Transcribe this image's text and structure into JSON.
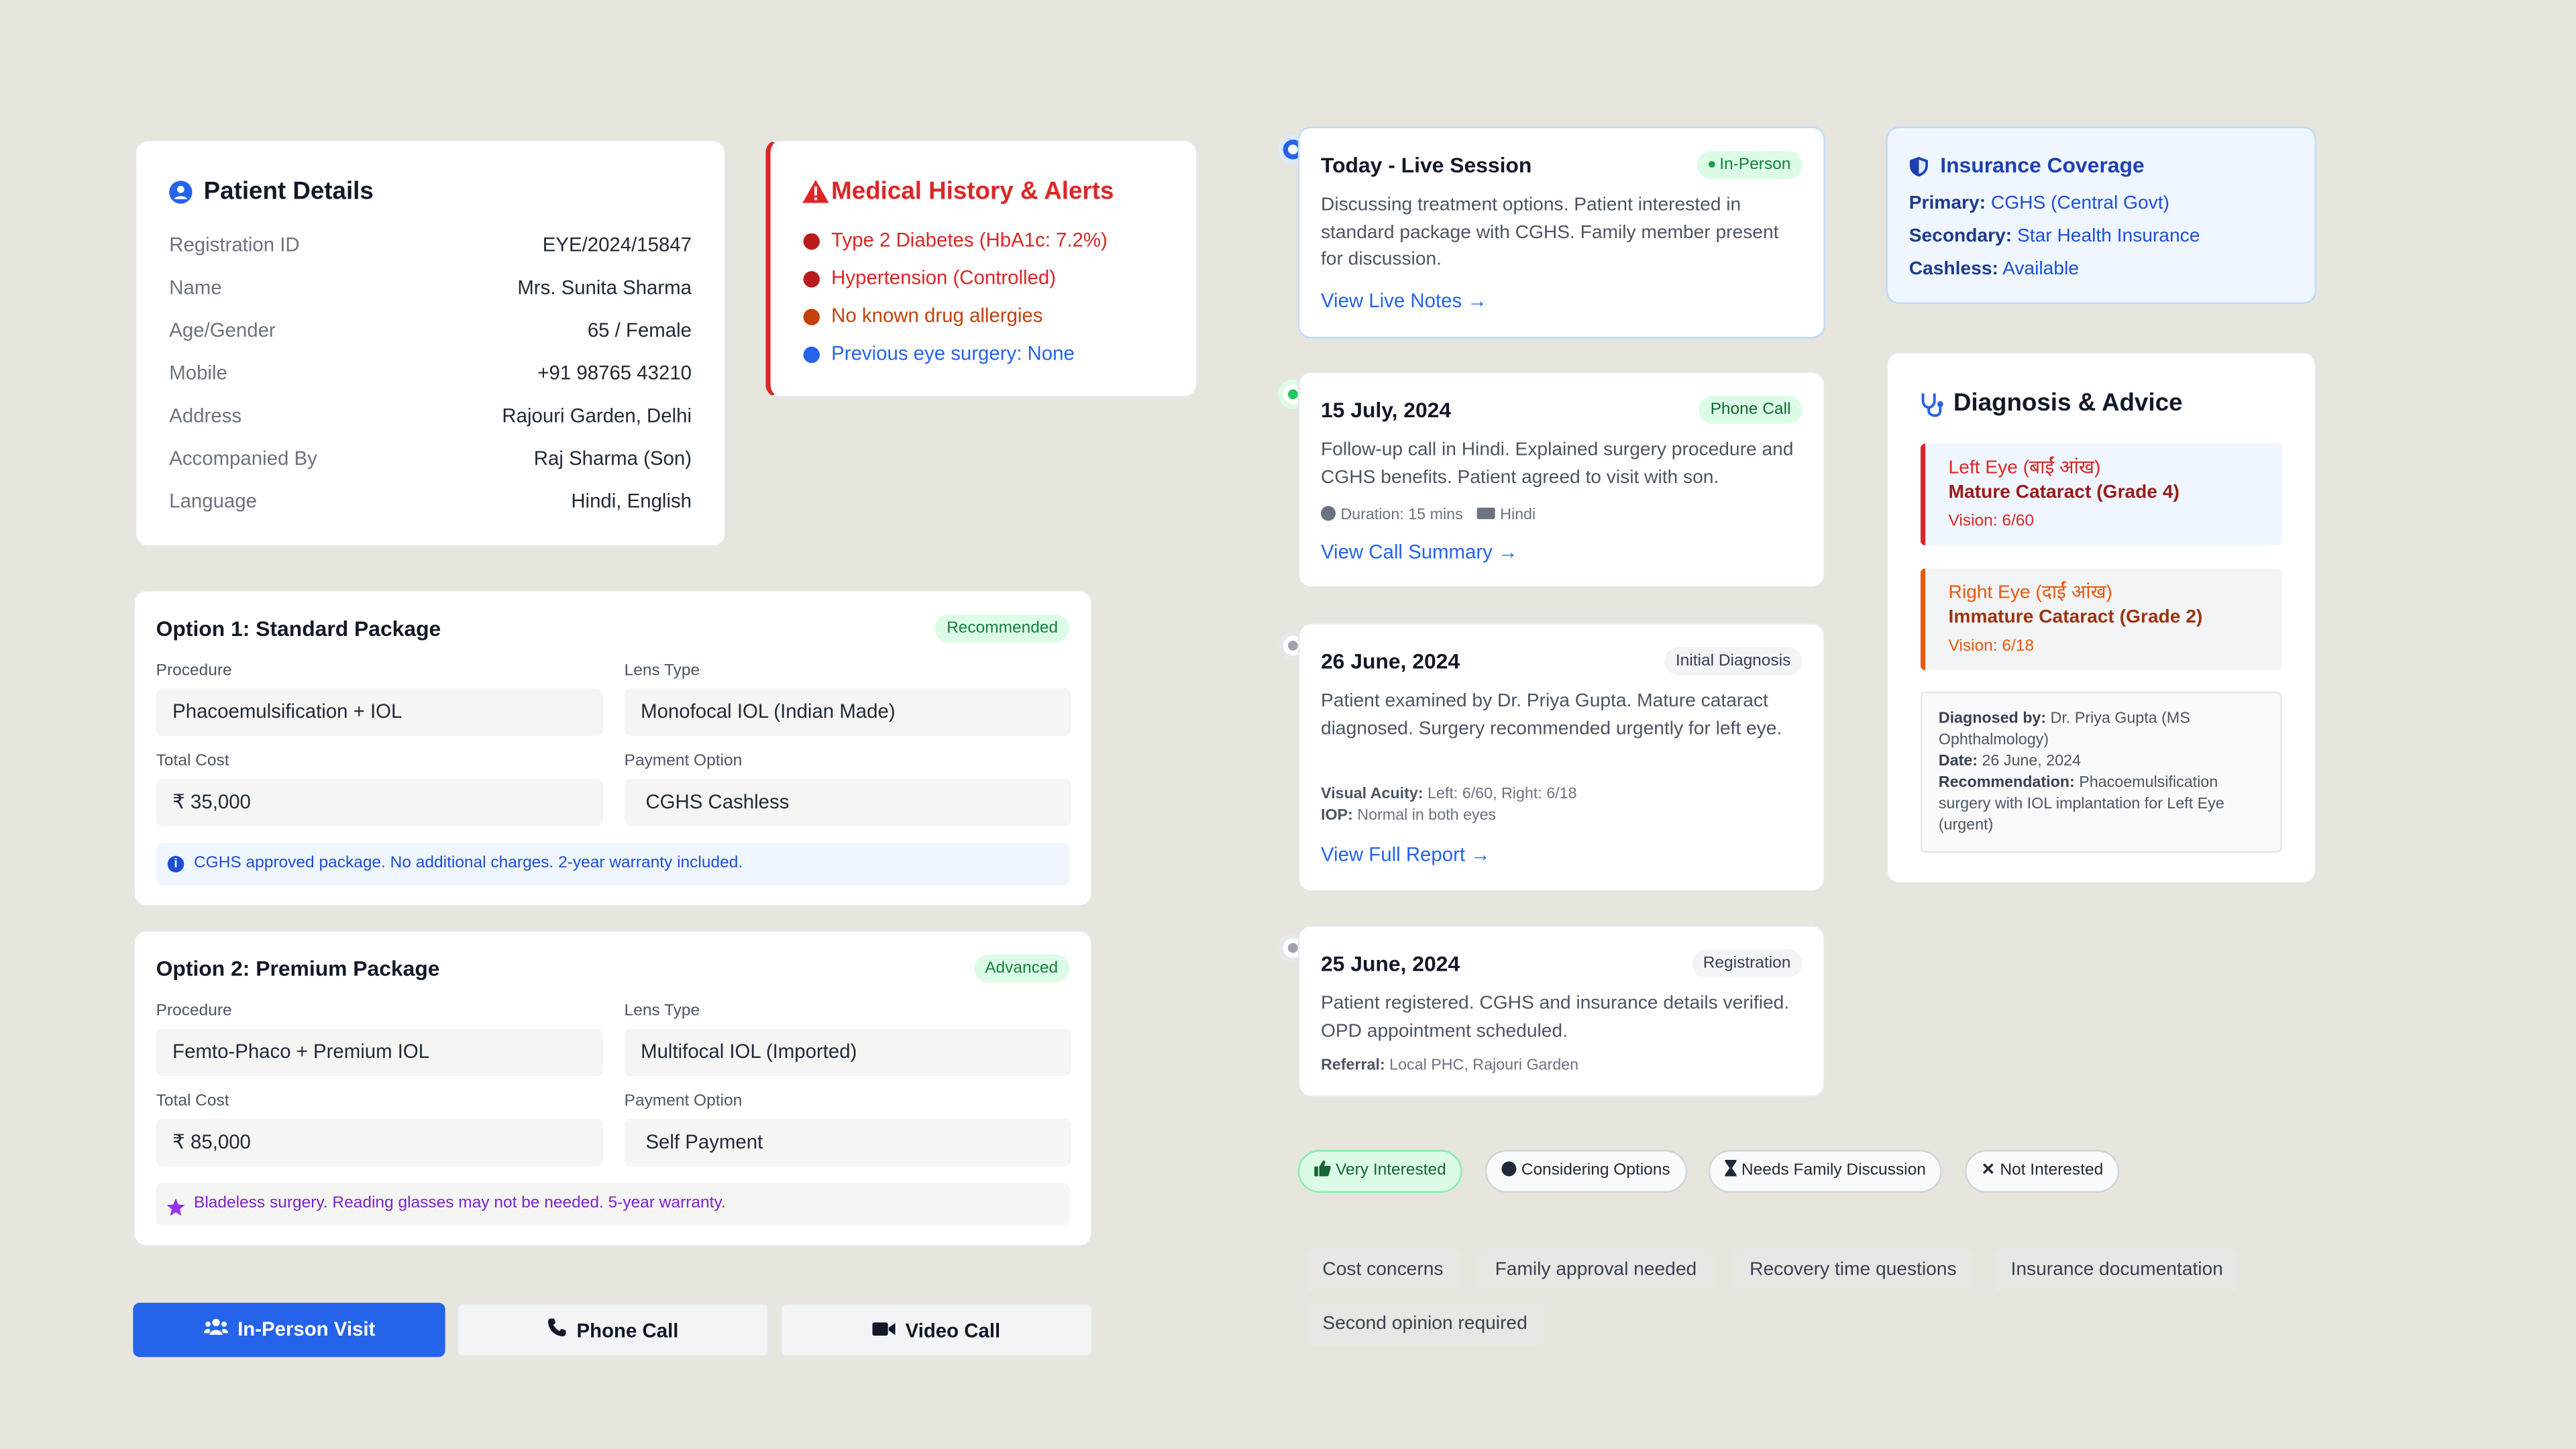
{
  "patient": {
    "title": "Patient Details",
    "rows": [
      {
        "label": "Registration ID",
        "value": "EYE/2024/15847"
      },
      {
        "label": "Name",
        "value": "Mrs. Sunita Sharma"
      },
      {
        "label": "Age/Gender",
        "value": "65 / Female"
      },
      {
        "label": "Mobile",
        "value": "+91 98765 43210"
      },
      {
        "label": "Address",
        "value": "Rajouri Garden, Delhi"
      },
      {
        "label": "Accompanied By",
        "value": "Raj Sharma (Son)"
      },
      {
        "label": "Language",
        "value": "Hindi, English"
      }
    ]
  },
  "medical": {
    "title": "Medical History & Alerts",
    "items": [
      {
        "text": "Type 2 Diabetes (HbA1c: 7.2%)",
        "color": "#dc2626"
      },
      {
        "text": "Hypertension (Controlled)",
        "color": "#dc2626"
      },
      {
        "text": "No known drug allergies",
        "color": "#c2410c"
      },
      {
        "text": "Previous eye surgery: None",
        "color": "#2563eb"
      }
    ]
  },
  "packages": [
    {
      "title": "Option 1: Standard Package",
      "badge": "Recommended",
      "procedure_label": "Procedure",
      "procedure": "Phacoemulsification + IOL",
      "lens_label": "Lens Type",
      "lens": "Monofocal IOL (Indian Made)",
      "cost_label": "Total Cost",
      "cost": "₹ 35,000",
      "payment_label": "Payment Option",
      "payment": "CGHS Cashless",
      "note": "CGHS approved package. No additional charges. 2-year warranty included."
    },
    {
      "title": "Option 2: Premium Package",
      "badge": "Advanced",
      "procedure_label": "Procedure",
      "procedure": "Femto-Phaco + Premium IOL",
      "lens_label": "Lens Type",
      "lens": "Multifocal IOL (Imported)",
      "cost_label": "Total Cost",
      "cost": "₹ 85,000",
      "payment_label": "Payment Option",
      "payment": "Self Payment",
      "note": "Bladeless surgery. Reading glasses may not be needed. 5-year warranty."
    }
  ],
  "modes": {
    "in_person": "In-Person Visit",
    "phone": "Phone Call",
    "video": "Video Call"
  },
  "timeline": [
    {
      "title": "Today - Live Session",
      "badge": "In-Person",
      "text": "Discussing treatment options. Patient interested in standard package with CGHS. Family member present for discussion.",
      "link": "View Live Notes →"
    },
    {
      "title": "15 July, 2024",
      "badge": "Phone Call",
      "text": "Follow-up call in Hindi. Explained surgery procedure and CGHS benefits. Patient agreed to visit with son.",
      "duration": "Duration: 15 mins",
      "language": "Hindi",
      "link": "View Call Summary →"
    },
    {
      "title": "26 June, 2024",
      "badge": "Initial Diagnosis",
      "text": "Patient examined by Dr. Priya Gupta. Mature cataract diagnosed. Surgery recommended urgently for left eye.",
      "va_label": "Visual Acuity:",
      "va_value": "Left: 6/60, Right: 6/18",
      "iop_label": "IOP:",
      "iop_value": "Normal in both eyes",
      "link": "View Full Report →"
    },
    {
      "title": "25 June, 2024",
      "badge": "Registration",
      "text": "Patient registered. CGHS and insurance details verified. OPD appointment scheduled.",
      "ref_label": "Referral:",
      "ref_value": "Local PHC, Rajouri Garden"
    }
  ],
  "insurance": {
    "title": "Insurance Coverage",
    "primary_label": "Primary:",
    "primary": "CGHS (Central Govt)",
    "secondary_label": "Secondary:",
    "secondary": "Star Health Insurance",
    "cashless_label": "Cashless:",
    "cashless": "Available"
  },
  "diagnosis": {
    "title": "Diagnosis & Advice",
    "left": {
      "eye": "Left Eye (बाईं आंख)",
      "condition": "Mature Cataract (Grade 4)",
      "vision": "Vision: 6/60"
    },
    "right": {
      "eye": "Right Eye (दाईं आंख)",
      "condition": "Immature Cataract (Grade 2)",
      "vision": "Vision: 6/18"
    },
    "by_label": "Diagnosed by:",
    "by": "Dr. Priya Gupta (MS Ophthalmology)",
    "date_label": "Date:",
    "date": "26 June, 2024",
    "rec_label": "Recommendation:",
    "rec": "Phacoemulsification surgery with IOL implantation for Left Eye (urgent)"
  },
  "interest": {
    "options": [
      "Very Interested",
      "Considering Options",
      "Needs Family Discussion",
      "Not Interested"
    ],
    "selected": "Very Interested"
  },
  "concerns": [
    "Cost concerns",
    "Family approval needed",
    "Recovery time questions",
    "Insurance documentation",
    "Second opinion required"
  ]
}
